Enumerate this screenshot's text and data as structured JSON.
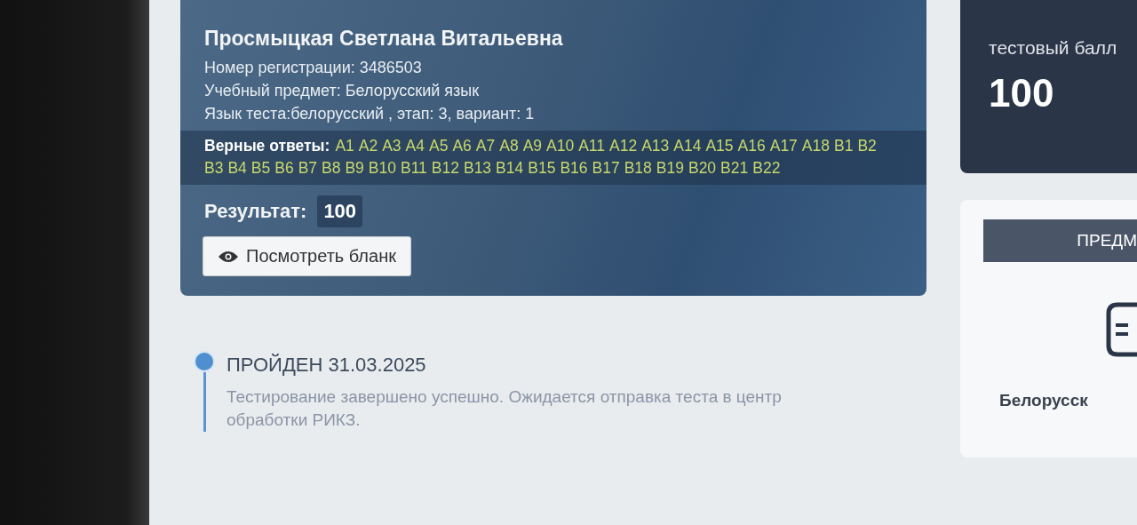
{
  "candidate": {
    "name": "Просмыцкая Светлана Витальевна",
    "details": [
      "Номер регистрации: 3486503",
      "Учебный предмет: Белорусский язык",
      "Язык теста:белорусский , этап: 3, вариант: 1"
    ],
    "correct_answers_label": "Верные ответы:",
    "correct_answers": [
      "A1",
      "A2",
      "A3",
      "A4",
      "A5",
      "A6",
      "A7",
      "A8",
      "A9",
      "A10",
      "A11",
      "A12",
      "A13",
      "A14",
      "A15",
      "A16",
      "A17",
      "A18",
      "B1",
      "B2",
      "B3",
      "B4",
      "B5",
      "B6",
      "B7",
      "B8",
      "B9",
      "B10",
      "B11",
      "B12",
      "B13",
      "B14",
      "B15",
      "B16",
      "B17",
      "B18",
      "B19",
      "B20",
      "B21",
      "B22"
    ],
    "result_label": "Результат:",
    "result": "100",
    "view_button": "Посмотреть бланк"
  },
  "timeline": [
    {
      "status": "ПРОЙДЕН 31.03.2025",
      "description": "Тестирование завершено успешно. Ожидается отправка теста в центр обработки РИКЗ."
    }
  ],
  "score_card": {
    "label": "тестовый балл",
    "value": "100"
  },
  "subject_card": {
    "header": "ПРЕДМ",
    "subject": "Белорусск"
  }
}
